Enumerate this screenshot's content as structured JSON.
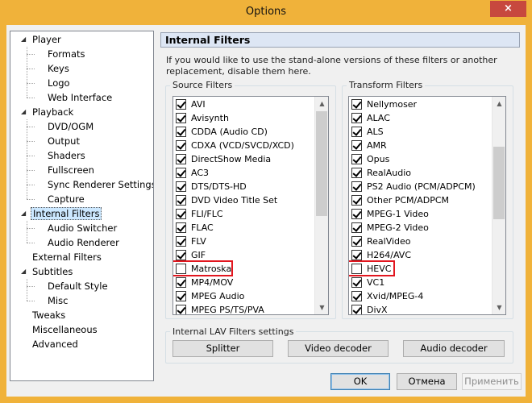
{
  "window": {
    "title": "Options",
    "close_icon": "×"
  },
  "tree": [
    {
      "label": "Player",
      "level": 0,
      "expander": "◢"
    },
    {
      "label": "Formats",
      "level": 1
    },
    {
      "label": "Keys",
      "level": 1
    },
    {
      "label": "Logo",
      "level": 1
    },
    {
      "label": "Web Interface",
      "level": 1
    },
    {
      "label": "Playback",
      "level": 0,
      "expander": "◢"
    },
    {
      "label": "DVD/OGM",
      "level": 1
    },
    {
      "label": "Output",
      "level": 1
    },
    {
      "label": "Shaders",
      "level": 1
    },
    {
      "label": "Fullscreen",
      "level": 1
    },
    {
      "label": "Sync Renderer Settings",
      "level": 1
    },
    {
      "label": "Capture",
      "level": 1
    },
    {
      "label": "Internal Filters",
      "level": 0,
      "expander": "◢",
      "selected": true
    },
    {
      "label": "Audio Switcher",
      "level": 1
    },
    {
      "label": "Audio Renderer",
      "level": 1
    },
    {
      "label": "External Filters",
      "level": 0
    },
    {
      "label": "Subtitles",
      "level": 0,
      "expander": "◢"
    },
    {
      "label": "Default Style",
      "level": 1
    },
    {
      "label": "Misc",
      "level": 1
    },
    {
      "label": "Tweaks",
      "level": 0
    },
    {
      "label": "Miscellaneous",
      "level": 0
    },
    {
      "label": "Advanced",
      "level": 0
    }
  ],
  "page": {
    "header": "Internal Filters",
    "description": "If you would like to use the stand-alone versions of these filters or another replacement, disable them here."
  },
  "source_filters": {
    "title": "Source Filters",
    "items": [
      {
        "label": "AVI",
        "checked": true
      },
      {
        "label": "Avisynth",
        "checked": true
      },
      {
        "label": "CDDA (Audio CD)",
        "checked": true
      },
      {
        "label": "CDXA (VCD/SVCD/XCD)",
        "checked": true
      },
      {
        "label": "DirectShow Media",
        "checked": true
      },
      {
        "label": "AC3",
        "checked": true
      },
      {
        "label": "DTS/DTS-HD",
        "checked": true
      },
      {
        "label": "DVD Video Title Set",
        "checked": true
      },
      {
        "label": "FLI/FLC",
        "checked": true
      },
      {
        "label": "FLAC",
        "checked": true
      },
      {
        "label": "FLV",
        "checked": true
      },
      {
        "label": "GIF",
        "checked": true
      },
      {
        "label": "Matroska",
        "checked": false,
        "highlighted": true
      },
      {
        "label": "MP4/MOV",
        "checked": true
      },
      {
        "label": "MPEG Audio",
        "checked": true
      },
      {
        "label": "MPEG PS/TS/PVA",
        "checked": true
      }
    ]
  },
  "transform_filters": {
    "title": "Transform Filters",
    "items": [
      {
        "label": "Nellymoser",
        "checked": true
      },
      {
        "label": "ALAC",
        "checked": true
      },
      {
        "label": "ALS",
        "checked": true
      },
      {
        "label": "AMR",
        "checked": true
      },
      {
        "label": "Opus",
        "checked": true
      },
      {
        "label": "RealAudio",
        "checked": true
      },
      {
        "label": "PS2 Audio (PCM/ADPCM)",
        "checked": true
      },
      {
        "label": "Other PCM/ADPCM",
        "checked": true
      },
      {
        "label": "MPEG-1 Video",
        "checked": true
      },
      {
        "label": "MPEG-2 Video",
        "checked": true
      },
      {
        "label": "RealVideo",
        "checked": true
      },
      {
        "label": "H264/AVC",
        "checked": true
      },
      {
        "label": "HEVC",
        "checked": false,
        "highlighted": true
      },
      {
        "label": "VC1",
        "checked": true
      },
      {
        "label": "Xvid/MPEG-4",
        "checked": true
      },
      {
        "label": "DivX",
        "checked": true
      }
    ]
  },
  "lav": {
    "title": "Internal LAV Filters settings",
    "splitter": "Splitter",
    "video": "Video decoder",
    "audio": "Audio decoder"
  },
  "footer": {
    "ok": "OK",
    "cancel": "Отмена",
    "apply": "Применить"
  },
  "colors": {
    "frame": "#f0b23a",
    "highlight": "#e2161f",
    "close": "#c7483e"
  }
}
